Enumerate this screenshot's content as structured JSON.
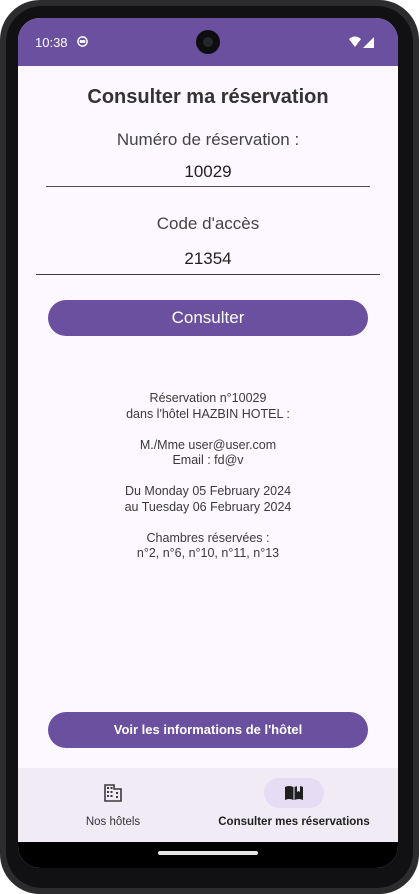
{
  "status_bar": {
    "time": "10:38",
    "background": "#6a509e"
  },
  "page": {
    "title": "Consulter ma réservation"
  },
  "form": {
    "reservation_label": "Numéro de réservation :",
    "reservation_value": "10029",
    "access_label": "Code d'accès",
    "access_value": "21354",
    "consult_button": "Consulter"
  },
  "result": {
    "line1": "Réservation n°10029",
    "line2": "dans l'hôtel HAZBIN HOTEL :",
    "line3": "M./Mme user@user.com",
    "line4": "Email : fd@v",
    "line5": "Du Monday 05 February 2024",
    "line6": "au Tuesday 06 February 2024",
    "line7": "Chambres réservées :",
    "line8": "n°2, n°6, n°10, n°11, n°13"
  },
  "hotel_button": "Voir les informations de l'hôtel",
  "bottom_nav": {
    "items": [
      {
        "label": "Nos hôtels",
        "icon": "building-icon",
        "selected": false
      },
      {
        "label": "Consulter mes réservations",
        "icon": "book-icon",
        "selected": true
      }
    ]
  },
  "colors": {
    "accent": "#6a509e",
    "background": "#fdf7ff",
    "nav_background": "#f1ebf6",
    "nav_indicator": "#e6dcf4"
  }
}
